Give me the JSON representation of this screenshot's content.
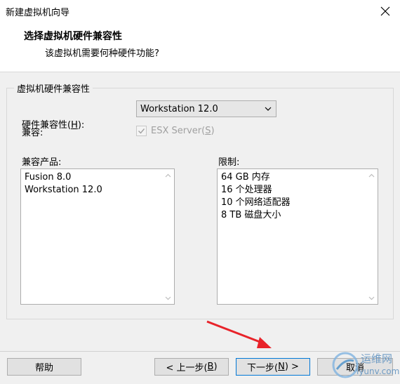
{
  "window": {
    "title": "新建虚拟机向导"
  },
  "header": {
    "title": "选择虚拟机硬件兼容性",
    "subtitle": "该虚拟机需要何种硬件功能?"
  },
  "group": {
    "label": "虚拟机硬件兼容性",
    "compat_label": "硬件兼容性(",
    "compat_key": "H",
    "compat_label_end": "):",
    "compat_value": "Workstation 12.0",
    "compatible_label": "兼容:",
    "esx_label": "ESX Server(",
    "esx_key": "S",
    "esx_label_end": ")",
    "products_label": "兼容产品:",
    "products": [
      "Fusion 8.0",
      "Workstation 12.0"
    ],
    "limits_label": "限制:",
    "limits": [
      "64 GB 内存",
      "16 个处理器",
      "10 个网络适配器",
      "8 TB 磁盘大小"
    ]
  },
  "footer": {
    "help": "帮助",
    "back_pre": "< 上一步(",
    "back_key": "B",
    "back_post": ")",
    "next_pre": "下一步(",
    "next_key": "N",
    "next_post": ") >",
    "cancel": "取消"
  },
  "watermark": {
    "text": "运维网",
    "sub": "iyunv.com"
  }
}
